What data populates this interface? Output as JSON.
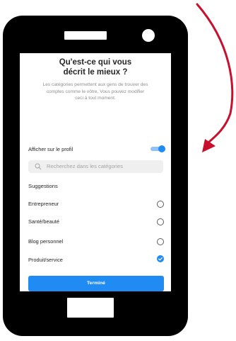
{
  "screen": {
    "title_line1": "Qu'est-ce qui vous",
    "title_line2": "décrit le mieux ?",
    "subtitle_line1": "Les catégories permettent aux gens de trouver des",
    "subtitle_line2": "comptes comme le vôtre. Vous pouvez modifier",
    "subtitle_line3": "ceci à tout moment."
  },
  "profile_toggle": {
    "label": "Afficher sur le profil",
    "enabled": true
  },
  "search": {
    "placeholder": "Recherchez dans les catégories",
    "icon": "search-icon"
  },
  "suggestions": {
    "title": "Suggestions",
    "items": [
      {
        "label": "Entrepreneur",
        "selected": false
      },
      {
        "label": "Santé/beauté",
        "selected": false
      },
      {
        "label": "Blog personnel",
        "selected": false
      },
      {
        "label": "Produit/service",
        "selected": true
      }
    ]
  },
  "done_button": {
    "label": "Terminé"
  },
  "colors": {
    "accent": "#1f8bf3",
    "arrow": "#c8102e",
    "phone_body": "#000000"
  }
}
